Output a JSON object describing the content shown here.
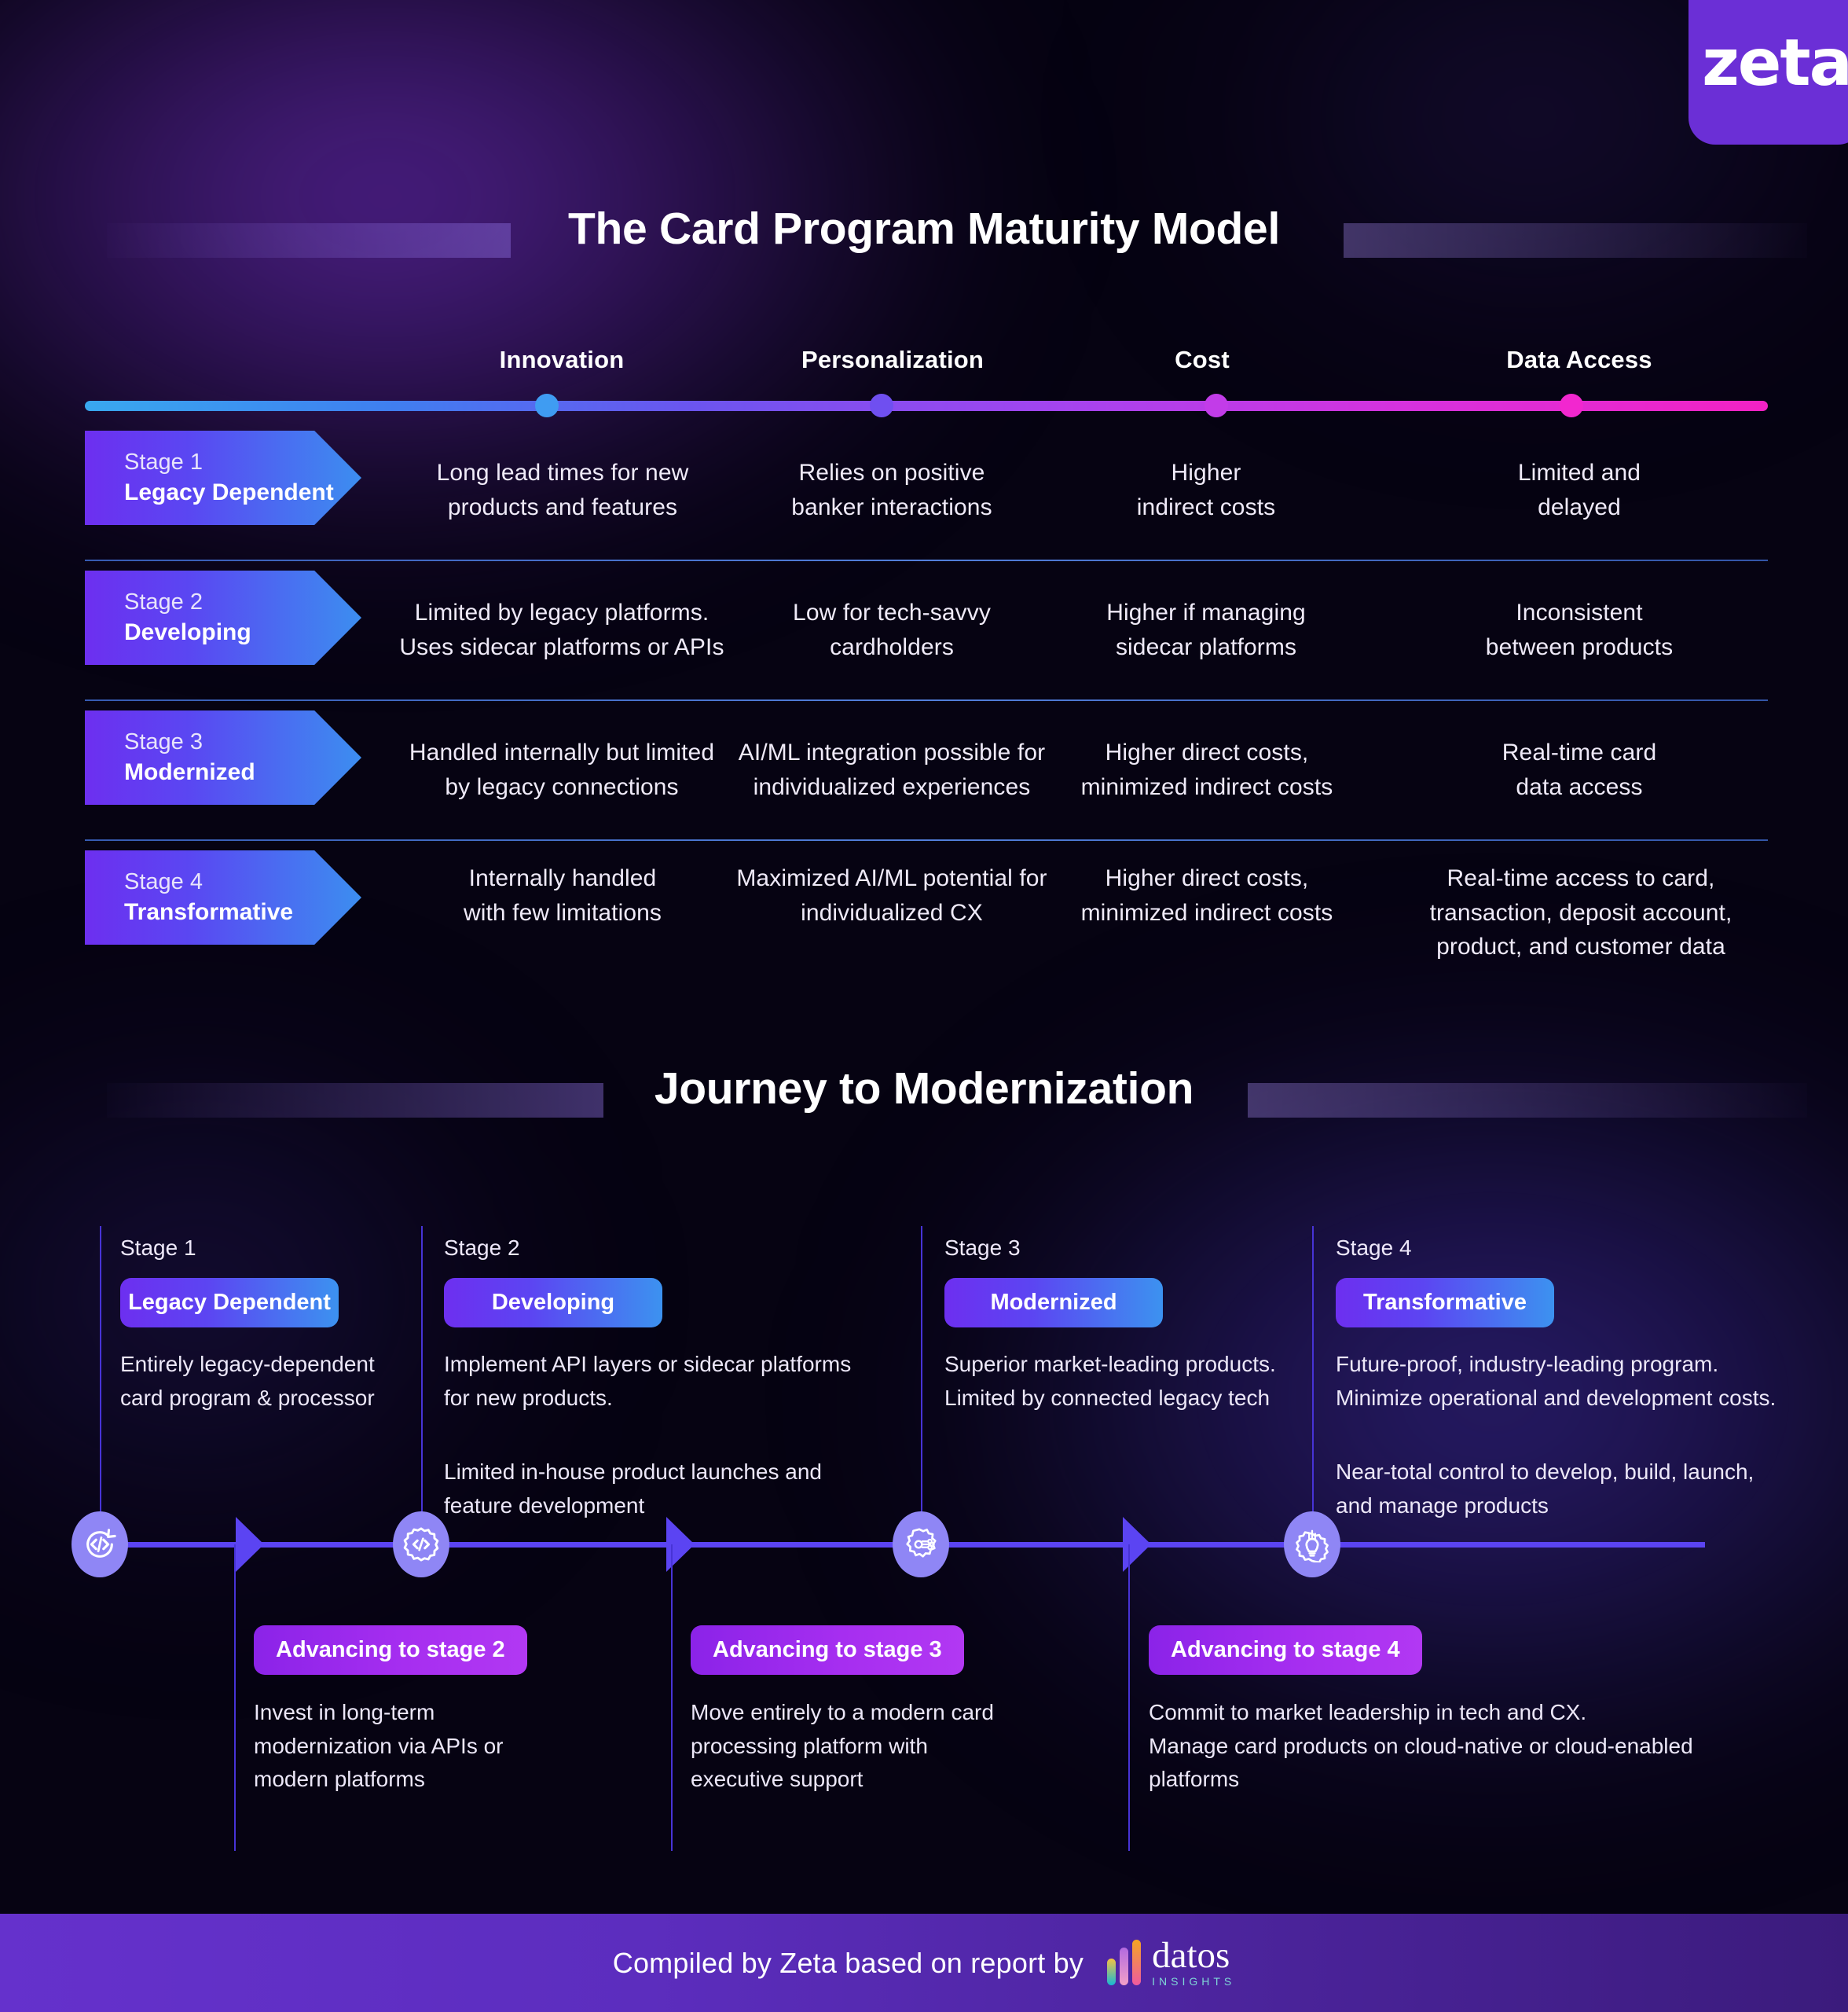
{
  "brand": {
    "logo_text": "zeta"
  },
  "matrix": {
    "title": "The Card Program Maturity Model",
    "columns": [
      "Innovation",
      "Personalization",
      "Cost",
      "Data Access"
    ],
    "rows": [
      {
        "stage_num": "Stage 1",
        "stage_name": "Legacy Dependent",
        "cells": [
          "Long lead times for new\nproducts and features",
          "Relies on positive\nbanker interactions",
          "Higher\nindirect costs",
          "Limited and\ndelayed"
        ]
      },
      {
        "stage_num": "Stage 2",
        "stage_name": "Developing",
        "cells": [
          "Limited by legacy platforms.\nUses sidecar platforms or APIs",
          "Low for tech-savvy\ncardholders",
          "Higher if managing\nsidecar platforms",
          "Inconsistent\nbetween products"
        ]
      },
      {
        "stage_num": "Stage 3",
        "stage_name": "Modernized",
        "cells": [
          "Handled internally but limited\nby legacy connections",
          "AI/ML integration possible for\nindividualized experiences",
          "Higher direct costs,\nminimized indirect costs",
          "Real-time card\ndata access"
        ]
      },
      {
        "stage_num": "Stage 4",
        "stage_name": "Transformative",
        "cells": [
          "Internally handled\nwith few limitations",
          "Maximized AI/ML potential for\nindividualized CX",
          "Higher direct costs,\nminimized indirect costs",
          "Real-time access to card,\ntransaction, deposit account,\nproduct, and customer data"
        ]
      }
    ]
  },
  "journey": {
    "title": "Journey to Modernization",
    "stages": [
      {
        "stage_num": "Stage 1",
        "badge": "Legacy Dependent",
        "icon": "code-refresh-icon",
        "body_1": "Entirely legacy-dependent\ncard program & processor",
        "body_2": ""
      },
      {
        "stage_num": "Stage 2",
        "badge": "Developing",
        "icon": "gear-code-icon",
        "body_1": "Implement API layers or sidecar platforms\nfor new products.",
        "body_2": "Limited in-house product launches and\nfeature development"
      },
      {
        "stage_num": "Stage 3",
        "badge": "Modernized",
        "icon": "gear-circuit-icon",
        "body_1": "Superior market-leading products.\nLimited by connected legacy tech",
        "body_2": ""
      },
      {
        "stage_num": "Stage 4",
        "badge": "Transformative",
        "icon": "gear-lightbulb-icon",
        "body_1": "Future-proof, industry-leading program.\nMinimize operational and development costs.",
        "body_2": "Near-total control to develop, build, launch,\nand manage products"
      }
    ],
    "transitions": [
      {
        "badge": "Advancing to stage 2",
        "body": "Invest in long-term\nmodernization via APIs or\nmodern platforms"
      },
      {
        "badge": "Advancing to stage 3",
        "body": "Move entirely to a modern card\nprocessing platform with\nexecutive support"
      },
      {
        "badge": "Advancing to stage 4",
        "body": "Commit to market leadership in tech and CX.\nManage card products on cloud-native or cloud-enabled\nplatforms"
      }
    ]
  },
  "footer": {
    "text": "Compiled by Zeta based on report by",
    "partner_name": "datos",
    "partner_tagline": "INSIGHTS"
  },
  "colors": {
    "background": "#060312",
    "brand_purple": "#6b2fd6",
    "rail_start": "#39a8ef",
    "rail_end": "#f222c4",
    "chevron_start": "#6d2ff0",
    "chevron_end": "#3c8ef0",
    "advance_badge": "#a62ef0",
    "timeline": "#5b44f2",
    "icon_circle": "#8f86f5"
  },
  "chart_data": {
    "type": "table",
    "title": "The Card Program Maturity Model",
    "columns": [
      "Stage",
      "Innovation",
      "Personalization",
      "Cost",
      "Data Access"
    ],
    "rows": [
      [
        "Stage 1 — Legacy Dependent",
        "Long lead times for new products and features",
        "Relies on positive banker interactions",
        "Higher indirect costs",
        "Limited and delayed"
      ],
      [
        "Stage 2 — Developing",
        "Limited by legacy platforms. Uses sidecar platforms or APIs",
        "Low for tech-savvy cardholders",
        "Higher if managing sidecar platforms",
        "Inconsistent between products"
      ],
      [
        "Stage 3 — Modernized",
        "Handled internally but limited by legacy connections",
        "AI/ML integration possible for individualized experiences",
        "Higher direct costs, minimized indirect costs",
        "Real-time card data access"
      ],
      [
        "Stage 4 — Transformative",
        "Internally handled with few limitations",
        "Maximized AI/ML potential for individualized CX",
        "Higher direct costs, minimized indirect costs",
        "Real-time access to card, transaction, deposit account, product, and customer data"
      ]
    ],
    "gradient_axis": {
      "from": "Innovation",
      "to": "Data Access",
      "color_from": "#39a8ef",
      "color_to": "#f222c4"
    }
  }
}
